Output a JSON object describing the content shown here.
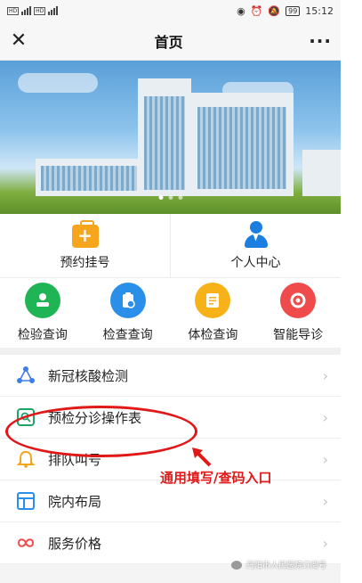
{
  "status_bar": {
    "left": "HD ull HD ull",
    "battery": "99",
    "time": "15:12"
  },
  "nav": {
    "title": "首页",
    "close_glyph": "✕",
    "more_glyph": "···"
  },
  "main_buttons": [
    {
      "label": "预约挂号",
      "icon": "medical-bag-icon",
      "color": "#f7a51c"
    },
    {
      "label": "个人中心",
      "icon": "person-icon",
      "color": "#1b7fe0"
    }
  ],
  "grid": [
    {
      "label": "检验查询",
      "icon": "lab-test-icon",
      "color": "#1fb454"
    },
    {
      "label": "检查查询",
      "icon": "clipboard-check-icon",
      "color": "#2a8fe8"
    },
    {
      "label": "体检查询",
      "icon": "report-icon",
      "color": "#f7b21a"
    },
    {
      "label": "智能导诊",
      "icon": "guide-icon",
      "color": "#f04b4b"
    }
  ],
  "list": [
    {
      "label": "新冠核酸检测",
      "icon": "share-nodes-icon"
    },
    {
      "label": "预检分诊操作表",
      "icon": "form-search-icon"
    },
    {
      "label": "排队叫号",
      "icon": "bell-icon"
    },
    {
      "label": "院内布局",
      "icon": "layout-icon"
    },
    {
      "label": "服务价格",
      "icon": "link-icon"
    }
  ],
  "annotation": {
    "text": "通用填写/查码入口"
  },
  "watermark": "丹阳市人民医院订阅号",
  "colors": {
    "accent_red": "#e01818",
    "chevron": "#c4c4c4"
  }
}
